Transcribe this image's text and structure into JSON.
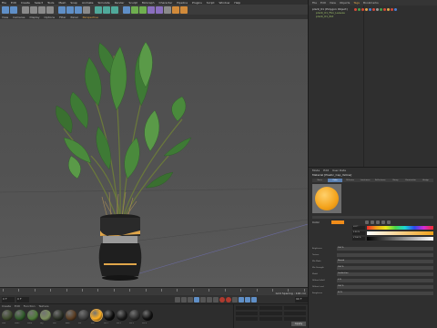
{
  "menubar": {
    "items": [
      "File",
      "Edit",
      "Create",
      "Select",
      "Tools",
      "Mesh",
      "Snap",
      "Animate",
      "Simulate",
      "Render",
      "Sculpt",
      "MoGraph",
      "Character",
      "Pipeline",
      "Plugins",
      "Script",
      "Window",
      "Help"
    ]
  },
  "viewport_menu": {
    "items": [
      "View",
      "Cameras",
      "Display",
      "Options",
      "Filter",
      "Panel"
    ],
    "active_label": "Perspective"
  },
  "timeline": {
    "readout": "Grid Spacing : 100 cm"
  },
  "transport": {
    "start_frame": "0 F",
    "current_frame": "0 F",
    "end_frame": "90 F"
  },
  "material_manager": {
    "menu": [
      "Create",
      "Edit",
      "Function",
      "Texture"
    ],
    "swatch_colors": [
      "#3d4a2c",
      "#2f5a2a",
      "#4e7a3a",
      "#7c8f5e",
      "#2a2f25",
      "#5a3d22",
      "#3b3b3b",
      "#ffb020",
      "#0d0d0d",
      "#1a1a1a",
      "#2c2c2c",
      "#111111"
    ],
    "labels": [
      "Leaf",
      "Leaf2",
      "Stem",
      "Dry",
      "Soil",
      "Bark",
      "Pot",
      "Mat",
      "Pot.1",
      "Pot.2",
      "Pot.3",
      "Pot.4"
    ],
    "selected_index": 7
  },
  "coordinates": {
    "apply_label": "Apply"
  },
  "object_manager": {
    "tabs": [
      "File",
      "Edit",
      "View",
      "Objects",
      "Tags",
      "Bookmarks"
    ],
    "active_tab": "Tags",
    "objects": [
      {
        "name": "plant_01 (Polygon Object)",
        "child": false
      },
      {
        "name": "plant_01_Fbx_Leaves",
        "child": true
      },
      {
        "name": "plant_01_Pot",
        "child": true
      }
    ],
    "tag_colors": [
      "#d64a3a",
      "#4aa04a",
      "#d64a3a",
      "#e0a64a",
      "#4a7fd6",
      "#d64a3a",
      "#999999",
      "#4aa04a",
      "#d64a3a",
      "#e0a64a",
      "#d64a3a",
      "#4a7fd6"
    ]
  },
  "attributes": {
    "menu": [
      "Mode",
      "Edit",
      "User Data"
    ],
    "title": "Material [Plastic_Cap_Yellow]",
    "subtabs": [
      "Basic",
      "Color",
      "Diffusion",
      "Luminance",
      "Reflectance",
      "Bump",
      "Illumination",
      "Assign"
    ],
    "active_subtab": "Color",
    "color_label": "Color",
    "sliders": [
      {
        "value": "H 37 °",
        "gradient": "linear-gradient(90deg,#f02b2b,#f0a21a,#e8e81a,#4ad64a,#1ad6d6,#2b4af0,#d62bd6,#f02b2b)"
      },
      {
        "value": "S 90 %",
        "gradient": "linear-gradient(90deg,#ffffff,#f0a21a)"
      },
      {
        "value": "V 100 %",
        "gradient": "linear-gradient(90deg,#000000,#ffffff)"
      }
    ],
    "properties": [
      {
        "label": "Brightness",
        "value": "100 %"
      },
      {
        "label": "Texture",
        "value": ""
      },
      {
        "label": "Mix Mode",
        "value": "Normal"
      },
      {
        "label": "Mix Strength",
        "value": "100 %"
      },
      {
        "label": "Model",
        "value": "Lambertian"
      },
      {
        "label": "Diffuse Falloff",
        "value": "0 %"
      },
      {
        "label": "Diffuse Level",
        "value": "100 %"
      },
      {
        "label": "Roughness",
        "value": "50 %"
      }
    ]
  }
}
